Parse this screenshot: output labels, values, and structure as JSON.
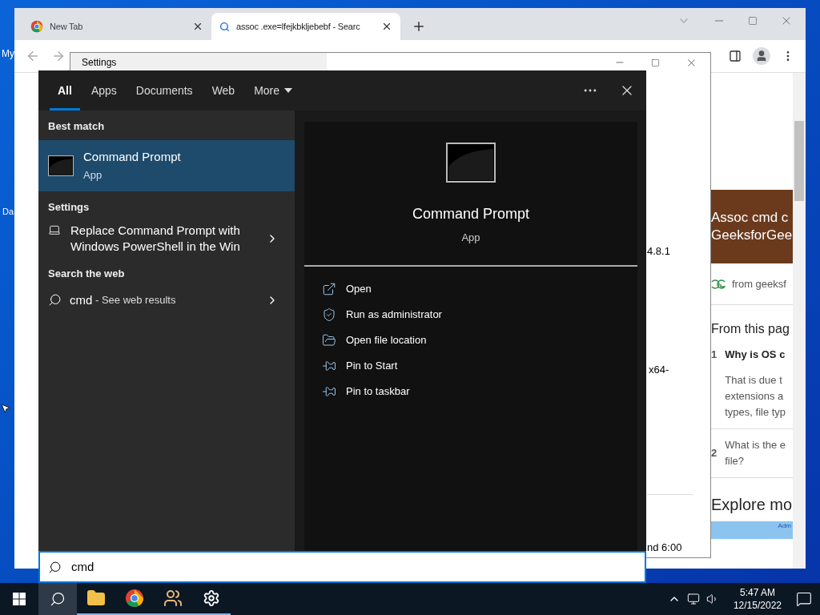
{
  "desktop": {
    "icon_labels": [
      "My",
      "Da"
    ]
  },
  "browser": {
    "tabs": [
      {
        "title": "New Tab",
        "kind": "newtab",
        "selected": false
      },
      {
        "title": "assoc .exe=lfejkbkljebebf - Searc",
        "kind": "search",
        "selected": true
      }
    ],
    "page": {
      "banner_lines": [
        "Assoc cmd c",
        "GeeksforGee"
      ],
      "source": "from geeksf",
      "section_title": "From this pag",
      "questions": [
        {
          "number": "1",
          "title": "Why is OS c",
          "answer_lines": [
            "That is due t",
            "extensions a",
            "types, file typ"
          ]
        },
        {
          "number": "2",
          "title_lines": [
            "What is the e",
            "file?"
          ]
        }
      ],
      "explore_title": "Explore mo",
      "thumbnail_label": "Adm"
    }
  },
  "settings_window": {
    "title": "Settings",
    "fragments": [
      "4.8.1",
      "x64-",
      "nd 6:00"
    ]
  },
  "search": {
    "tabs": [
      {
        "label": "All",
        "selected": true,
        "dropdown": false
      },
      {
        "label": "Apps",
        "selected": false,
        "dropdown": false
      },
      {
        "label": "Documents",
        "selected": false,
        "dropdown": false
      },
      {
        "label": "Web",
        "selected": false,
        "dropdown": false
      },
      {
        "label": "More",
        "selected": false,
        "dropdown": true
      }
    ],
    "best_match": {
      "heading": "Best match",
      "title": "Command Prompt",
      "subtitle": "App",
      "selected": true
    },
    "settings_result": {
      "heading": "Settings",
      "lines": [
        "Replace Command Prompt with",
        "Windows PowerShell in the Win"
      ]
    },
    "web_result": {
      "heading": "Search the web",
      "query": "cmd",
      "hint": " - See web results"
    },
    "preview": {
      "title": "Command Prompt",
      "subtitle": "App",
      "actions": [
        {
          "label": "Open",
          "kind": "open"
        },
        {
          "label": "Run as administrator",
          "kind": "admin"
        },
        {
          "label": "Open file location",
          "kind": "location"
        },
        {
          "label": "Pin to Start",
          "kind": "pin"
        },
        {
          "label": "Pin to taskbar",
          "kind": "pin"
        }
      ]
    },
    "query": "cmd"
  },
  "taskbar": {
    "apps": [
      {
        "kind": "search",
        "active": true,
        "running": false
      },
      {
        "kind": "explorer",
        "active": false,
        "running": true
      },
      {
        "kind": "chrome",
        "active": false,
        "running": true
      },
      {
        "kind": "people",
        "active": false,
        "running": true
      },
      {
        "kind": "settings",
        "active": false,
        "running": true
      }
    ],
    "time": "5:47 AM",
    "date": "12/15/2022"
  }
}
